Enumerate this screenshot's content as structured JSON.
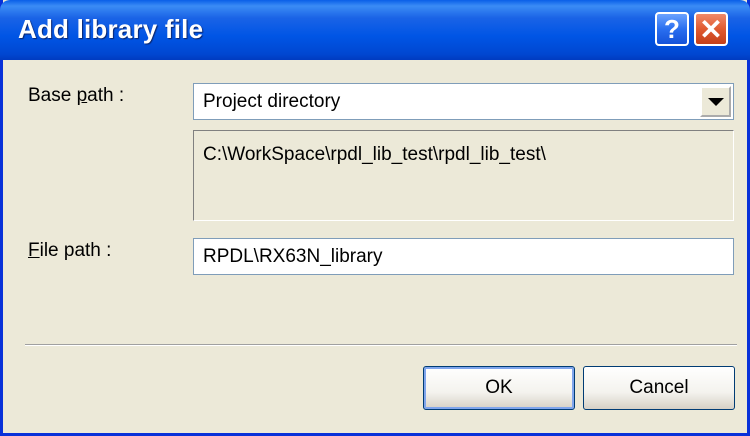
{
  "window": {
    "title": "Add library file",
    "help_label": "?",
    "close_label": "✕"
  },
  "base_path": {
    "label_prefix": "Base ",
    "label_accel": "p",
    "label_suffix": "ath :",
    "selected": "Project directory",
    "resolved_path": "C:\\WorkSpace\\rpdl_lib_test\\rpdl_lib_test\\"
  },
  "file_path": {
    "label_accel": "F",
    "label_suffix": "ile path :",
    "value": "RPDL\\RX63N_library"
  },
  "buttons": {
    "ok": "OK",
    "cancel": "Cancel"
  }
}
